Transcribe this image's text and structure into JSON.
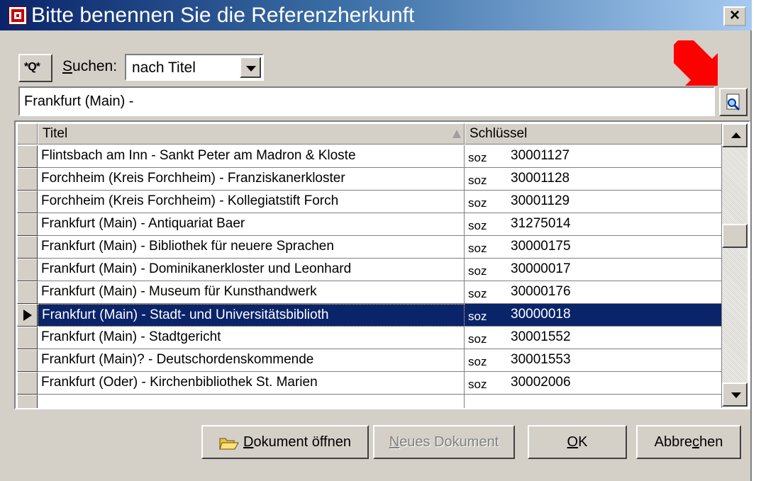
{
  "window": {
    "title": "Bitte benennen Sie die Referenzherkunft",
    "close_label": "×"
  },
  "toolbar": {
    "search_icon_text": "*Q*",
    "suchen_label_u": "S",
    "suchen_label_rest": "uchen:",
    "search_mode_selected": "nach Titel"
  },
  "search_input": {
    "value": "Frankfurt (Main) -"
  },
  "grid": {
    "columns": [
      {
        "label": "Titel",
        "sorted": "ascending"
      },
      {
        "label": "Schlüssel"
      }
    ],
    "rows": [
      {
        "title": "Flintsbach am Inn - Sankt Peter am Madron & Kloste",
        "prefix": "soz",
        "key": "30001127",
        "selected": false
      },
      {
        "title": "Forchheim (Kreis Forchheim) - Franziskanerkloster",
        "prefix": "soz",
        "key": "30001128",
        "selected": false
      },
      {
        "title": "Forchheim (Kreis Forchheim) - Kollegiatstift Forch",
        "prefix": "soz",
        "key": "30001129",
        "selected": false
      },
      {
        "title": "Frankfurt (Main) - Antiquariat Baer",
        "prefix": "soz",
        "key": "31275014",
        "selected": false
      },
      {
        "title": "Frankfurt (Main) - Bibliothek für neuere Sprachen",
        "prefix": "soz",
        "key": "30000175",
        "selected": false
      },
      {
        "title": "Frankfurt (Main) - Dominikanerkloster und Leonhard",
        "prefix": "soz",
        "key": "30000017",
        "selected": false
      },
      {
        "title": "Frankfurt (Main) - Museum für Kunsthandwerk",
        "prefix": "soz",
        "key": "30000176",
        "selected": false
      },
      {
        "title": "Frankfurt (Main) - Stadt- und Universitätsbiblioth",
        "prefix": "soz",
        "key": "30000018",
        "selected": true
      },
      {
        "title": "Frankfurt (Main) - Stadtgericht",
        "prefix": "soz",
        "key": "30001552",
        "selected": false
      },
      {
        "title": "Frankfurt (Main)? - Deutschordenskommende",
        "prefix": "soz",
        "key": "30001553",
        "selected": false
      },
      {
        "title": "Frankfurt (Oder) - Kirchenbibliothek St. Marien",
        "prefix": "soz",
        "key": "30002006",
        "selected": false
      }
    ]
  },
  "buttons": {
    "open_u": "D",
    "open_rest": "okument öffnen",
    "new_u": "N",
    "new_rest": "eues Dokument",
    "ok_u": "O",
    "ok_rest": "K",
    "cancel_pre": "Abbre",
    "cancel_u": "c",
    "cancel_rest": "hen"
  },
  "colors": {
    "selection": "#0a246a",
    "annotation_arrow": "#ff0000"
  }
}
